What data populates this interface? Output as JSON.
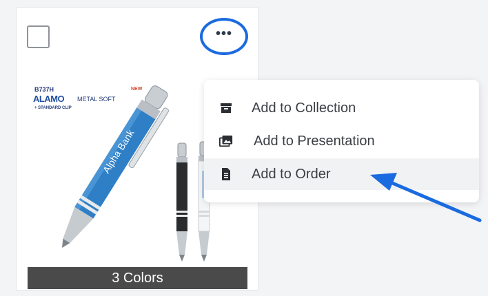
{
  "card": {
    "brand": {
      "sku": "B737H",
      "name": "ALAMO",
      "subtitle": "METAL SOFT",
      "badge": "NEW",
      "clip_note": "+ STANDARD CLIP"
    },
    "pen_imprint": "Alpha Bank",
    "colors_label": "3 Colors"
  },
  "more_button": {
    "icon": "ellipsis-icon",
    "glyph": "•••",
    "highlight_color": "#1a6ae0"
  },
  "menu": {
    "items": [
      {
        "label": "Add to Collection",
        "icon": "archive-box-icon"
      },
      {
        "label": "Add to Presentation",
        "icon": "image-gallery-icon"
      },
      {
        "label": "Add to Order",
        "icon": "document-icon"
      }
    ]
  },
  "annotation": {
    "arrow_color": "#1a6ae0"
  }
}
